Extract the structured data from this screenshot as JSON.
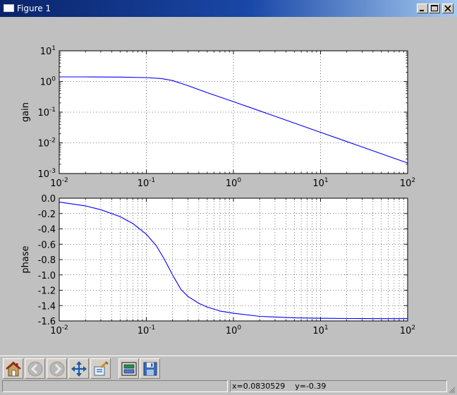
{
  "window": {
    "title": "Figure 1",
    "controls": [
      "minimize",
      "maximize",
      "close"
    ]
  },
  "toolbar": {
    "buttons": [
      {
        "name": "home",
        "icon": "home-icon",
        "enabled": true
      },
      {
        "name": "back",
        "icon": "back-arrow-icon",
        "enabled": false
      },
      {
        "name": "forward",
        "icon": "forward-arrow-icon",
        "enabled": false
      },
      {
        "name": "pan",
        "icon": "pan-arrows-icon",
        "enabled": true
      },
      {
        "name": "zoom",
        "icon": "zoom-rect-icon",
        "enabled": true
      },
      {
        "name": "subplots",
        "icon": "subplots-icon",
        "enabled": true
      },
      {
        "name": "save",
        "icon": "save-floppy-icon",
        "enabled": true
      }
    ]
  },
  "status": {
    "x_readout": "x=0.0830529",
    "y_readout": "y=-0.39"
  },
  "colors": {
    "line": "#0000ff",
    "titlebar_start": "#0a246a",
    "titlebar_end": "#a6caf0",
    "window_bg": "#c0c0c0"
  },
  "chart_data": [
    {
      "type": "line",
      "title": "",
      "xlabel": "",
      "ylabel": "gain",
      "xscale": "log",
      "yscale": "log",
      "xlim": [
        0.01,
        100
      ],
      "ylim": [
        0.001,
        10
      ],
      "grid": true,
      "x_tick_labels": [
        "10-2",
        "10-1",
        "100",
        "101",
        "102"
      ],
      "y_tick_labels": [
        "10-3",
        "10-2",
        "10-1",
        "100",
        "101"
      ],
      "series": [
        {
          "x": [
            0.01,
            0.02,
            0.05,
            0.1,
            0.15,
            0.2,
            0.3,
            0.5,
            1,
            2,
            5,
            10,
            20,
            50,
            100
          ],
          "y": [
            1.41,
            1.41,
            1.39,
            1.34,
            1.24,
            1.07,
            0.73,
            0.43,
            0.22,
            0.11,
            0.044,
            0.022,
            0.011,
            0.0044,
            0.0022
          ]
        }
      ]
    },
    {
      "type": "line",
      "title": "",
      "xlabel": "",
      "ylabel": "phase",
      "xscale": "log",
      "yscale": "linear",
      "xlim": [
        0.01,
        100
      ],
      "ylim": [
        -1.6,
        0.0
      ],
      "grid": true,
      "x_tick_labels": [
        "10-2",
        "10-1",
        "100",
        "101",
        "102"
      ],
      "y_tick_labels": [
        "0.0",
        "-0.2",
        "-0.4",
        "-0.6",
        "-0.8",
        "-1.0",
        "-1.2",
        "-1.4",
        "-1.6"
      ],
      "series": [
        {
          "x": [
            0.01,
            0.02,
            0.03,
            0.05,
            0.07,
            0.1,
            0.13,
            0.16,
            0.2,
            0.25,
            0.3,
            0.4,
            0.5,
            0.7,
            1,
            2,
            5,
            10,
            20,
            50,
            100
          ],
          "y": [
            -0.05,
            -0.1,
            -0.15,
            -0.24,
            -0.33,
            -0.47,
            -0.62,
            -0.79,
            -1.0,
            -1.19,
            -1.28,
            -1.37,
            -1.42,
            -1.47,
            -1.5,
            -1.54,
            -1.56,
            -1.565,
            -1.568,
            -1.57,
            -1.57
          ]
        }
      ]
    }
  ]
}
